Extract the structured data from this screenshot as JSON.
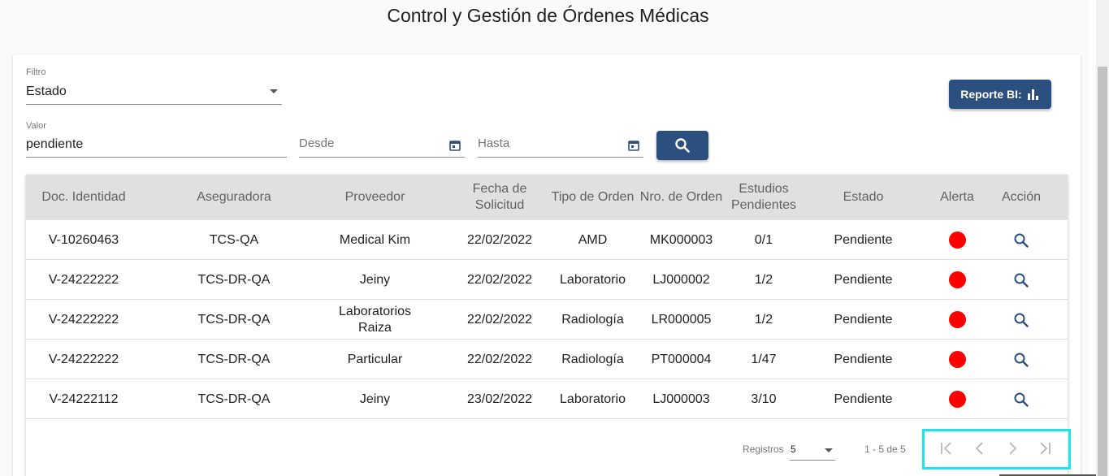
{
  "page": {
    "title": "Control y Gestión de Órdenes Médicas"
  },
  "filters": {
    "filter_label": "Filtro",
    "filter_value": "Estado",
    "value_label": "Valor",
    "value_value": "pendiente",
    "from_placeholder": "Desde",
    "to_placeholder": "Hasta"
  },
  "actions": {
    "report_label": "Reporte BI:",
    "report_icon": "bar-chart-icon",
    "search_icon": "search-icon"
  },
  "table": {
    "headers": {
      "doc": "Doc. Identidad",
      "insurer": "Aseguradora",
      "provider": "Proveedor",
      "date_line1": "Fecha de",
      "date_line2": "Solicitud",
      "order_type": "Tipo de Orden",
      "order_no": "Nro. de Orden",
      "pending_line1": "Estudios",
      "pending_line2": "Pendientes",
      "status": "Estado",
      "alert": "Alerta",
      "action": "Acción"
    },
    "rows": [
      {
        "doc": "V-10260463",
        "insurer": "TCS-QA",
        "provider_l1": "Medical Kim",
        "provider_l2": "",
        "date": "22/02/2022",
        "order_type": "AMD",
        "order_no": "MK000003",
        "pending": "0/1",
        "status": "Pendiente",
        "alert_color": "#ff0000"
      },
      {
        "doc": "V-24222222",
        "insurer": "TCS-DR-QA",
        "provider_l1": "Jeiny",
        "provider_l2": "",
        "date": "22/02/2022",
        "order_type": "Laboratorio",
        "order_no": "LJ000002",
        "pending": "1/2",
        "status": "Pendiente",
        "alert_color": "#ff0000"
      },
      {
        "doc": "V-24222222",
        "insurer": "TCS-DR-QA",
        "provider_l1": "Laboratorios",
        "provider_l2": "Raiza",
        "date": "22/02/2022",
        "order_type": "Radiología",
        "order_no": "LR000005",
        "pending": "1/2",
        "status": "Pendiente",
        "alert_color": "#ff0000"
      },
      {
        "doc": "V-24222222",
        "insurer": "TCS-DR-QA",
        "provider_l1": "Particular",
        "provider_l2": "",
        "date": "22/02/2022",
        "order_type": "Radiología",
        "order_no": "PT000004",
        "pending": "1/47",
        "status": "Pendiente",
        "alert_color": "#ff0000"
      },
      {
        "doc": "V-24222112",
        "insurer": "TCS-DR-QA",
        "provider_l1": "Jeiny",
        "provider_l2": "",
        "date": "23/02/2022",
        "order_type": "Laboratorio",
        "order_no": "LJ000003",
        "pending": "3/10",
        "status": "Pendiente",
        "alert_color": "#ff0000"
      }
    ]
  },
  "pagination": {
    "page_size_label": "Registros",
    "page_size_value": "5",
    "range_label": "1 - 5 de 5",
    "first_icon": "first-page-icon",
    "prev_icon": "chevron-left-icon",
    "next_icon": "chevron-right-icon",
    "last_icon": "last-page-icon",
    "highlight_color": "#20e3ec"
  },
  "colors": {
    "primary": "#2b4f7e",
    "alert": "#ff0000",
    "header_bg": "#e0e0e0"
  }
}
